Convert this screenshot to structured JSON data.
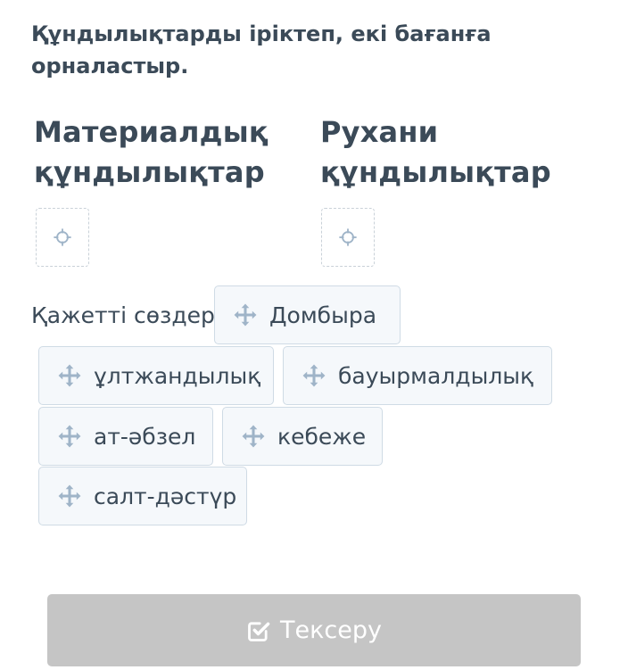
{
  "task": {
    "instruction": "Құндылықтарды іріктеп, екі бағанға орналастыр."
  },
  "columns": [
    {
      "title": "Материалдық құндылықтар"
    },
    {
      "title": "Рухани құндылықтар"
    }
  ],
  "word_bank": {
    "label": "Қажетті сөздер:",
    "items": [
      {
        "text": "Домбыра"
      },
      {
        "text": "ұлтжандылық"
      },
      {
        "text": "бауырмалдылық"
      },
      {
        "text": "ат-әбзел"
      },
      {
        "text": "кебеже"
      },
      {
        "text": "салт-дәстүр"
      }
    ]
  },
  "check_button": {
    "label": "Тексеру",
    "enabled": false
  },
  "colors": {
    "text": "#3b4a58",
    "icon": "#9fb4c8",
    "chip_bg": "#f5f8fb",
    "chip_border": "#cfdbe5",
    "dropzone_border": "#c9d1d8",
    "button_disabled_bg": "#c5c5c5"
  },
  "icons": {
    "drag_handle": "move-arrows-icon",
    "drop_target": "crosshair-icon",
    "check": "checkbox-check-icon"
  }
}
